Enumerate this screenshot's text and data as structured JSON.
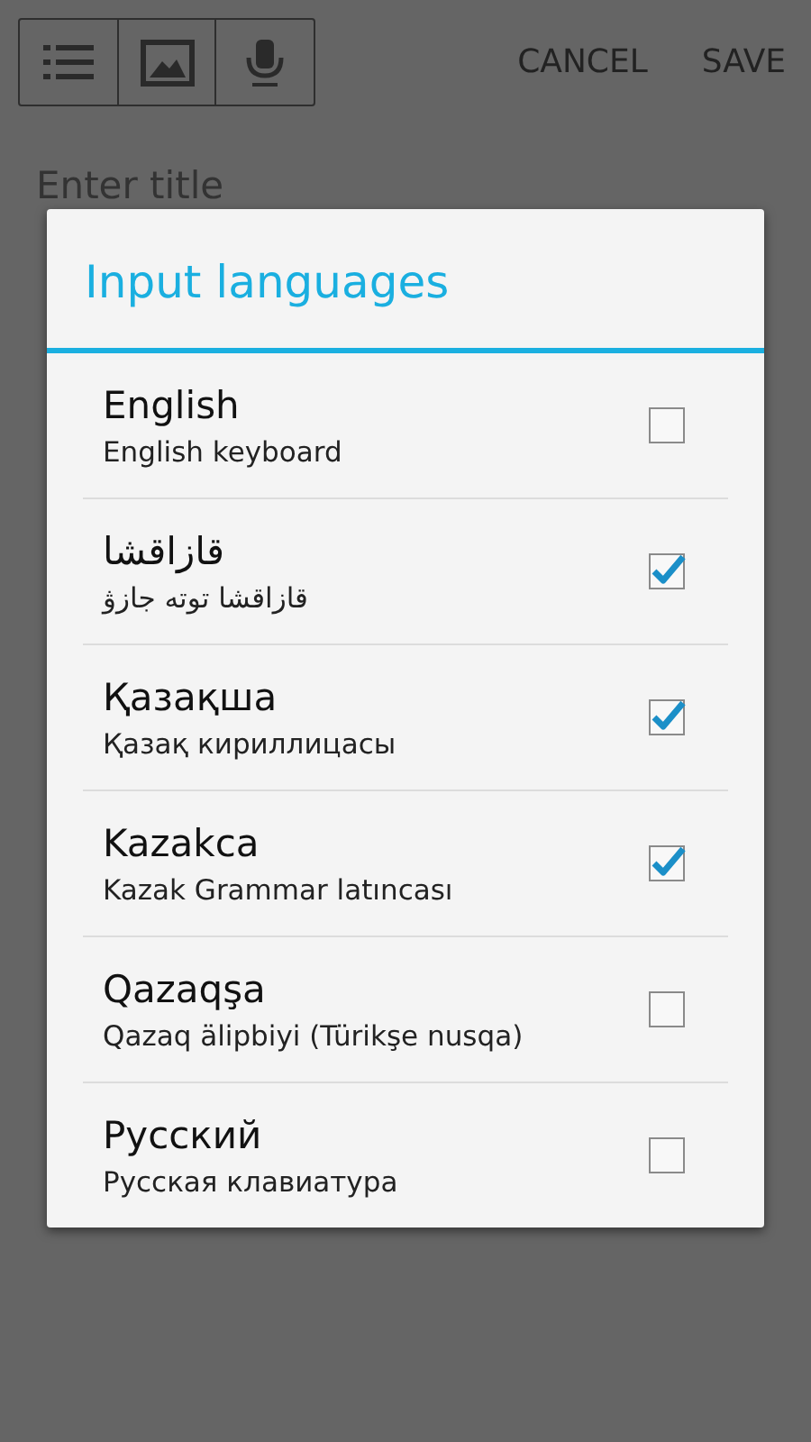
{
  "toolbar": {
    "tools": [
      {
        "kind": "list"
      },
      {
        "kind": "image"
      },
      {
        "kind": "mic"
      }
    ],
    "actions": [
      "CANCEL",
      "SAVE"
    ]
  },
  "editor": {
    "title_placeholder": "Enter title"
  },
  "dialog": {
    "title": "Input languages",
    "languages": [
      {
        "name": "English",
        "subtitle": "English keyboard",
        "checked": false
      },
      {
        "name": "قازاقشا",
        "subtitle": "قازاقشا توته جازۋ",
        "checked": true
      },
      {
        "name": "Қазақша",
        "subtitle": "Қазақ кириллицасы",
        "checked": true
      },
      {
        "name": "Kazakca",
        "subtitle": "Kazak Grammar latıncası",
        "checked": true
      },
      {
        "name": "Qazaqşa",
        "subtitle": "Qazaq älipbiyi (Türikşe nusqa)",
        "checked": false
      },
      {
        "name": "Русский",
        "subtitle": "Русская клавиатура",
        "checked": false
      }
    ]
  }
}
